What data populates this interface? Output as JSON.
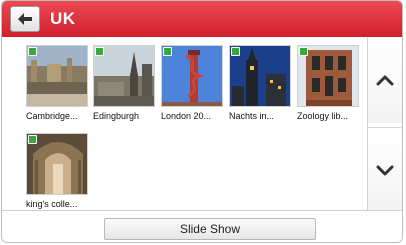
{
  "header": {
    "title": "UK",
    "back_icon": "back-arrow-icon"
  },
  "photos": [
    {
      "caption": "Cambridge..."
    },
    {
      "caption": "Edingburgh"
    },
    {
      "caption": "London 20..."
    },
    {
      "caption": "Nachts in..."
    },
    {
      "caption": "Zoology lib..."
    },
    {
      "caption": "king's colle..."
    }
  ],
  "scroll": {
    "up_icon": "chevron-up-icon",
    "down_icon": "chevron-down-icon"
  },
  "footer": {
    "slideshow_label": "Slide Show"
  },
  "colors": {
    "header_red": "#d9343d",
    "badge_green": "#3aa83a"
  }
}
